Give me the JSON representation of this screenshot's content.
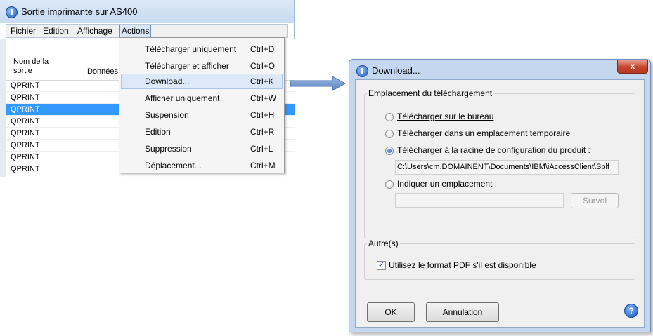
{
  "left_window": {
    "title": "Sortie imprimante sur AS400",
    "menubar": [
      "Fichier",
      "Edition",
      "Affichage",
      "Actions"
    ],
    "columns": [
      "Nom de la sortie",
      "Données"
    ],
    "rows": [
      "QPRINT",
      "QPRINT",
      "QPRINT",
      "QPRINT",
      "QPRINT",
      "QPRINT",
      "QPRINT",
      "QPRINT"
    ],
    "selected_row": 2,
    "actions_menu": [
      {
        "label": "Télécharger uniquement",
        "shortcut": "Ctrl+D"
      },
      {
        "label": "Télécharger et afficher",
        "shortcut": "Ctrl+O"
      },
      {
        "label": "Download...",
        "shortcut": "Ctrl+K"
      },
      {
        "label": "Afficher uniquement",
        "shortcut": "Ctrl+W"
      },
      {
        "label": "Suspension",
        "shortcut": "Ctrl+H"
      },
      {
        "label": "Edition",
        "shortcut": "Ctrl+R"
      },
      {
        "label": "Suppression",
        "shortcut": "Ctrl+L"
      },
      {
        "label": "Déplacement...",
        "shortcut": "Ctrl+M"
      }
    ],
    "highlighted_menu_item": 2
  },
  "dialog": {
    "title": "Download...",
    "close_label": "x",
    "location_group": {
      "legend": "Emplacement du téléchargement",
      "options": [
        "Télécharger sur le bureau",
        "Télécharger dans un emplacement temporaire",
        "Télécharger à la racine de configuration du produit :",
        "Indiquer un emplacement :"
      ],
      "selected_option": 2,
      "config_path": "C:\\Users\\cm.DOMAINENT\\Documents\\IBM\\iAccessClient\\Splf",
      "custom_path": "",
      "browse_label": "Survol"
    },
    "other_group": {
      "legend": "Autre(s)",
      "pdf_checkbox_label": "Utilisez le format PDF s'il est disponible",
      "pdf_checked": true
    },
    "ok_label": "OK",
    "cancel_label": "Annulation",
    "help_label": "?"
  },
  "colors": {
    "selection": "#3399ff",
    "title_bar": "#c4d7ee",
    "arrow": "#6d93c9",
    "close_button": "#c8452f"
  }
}
